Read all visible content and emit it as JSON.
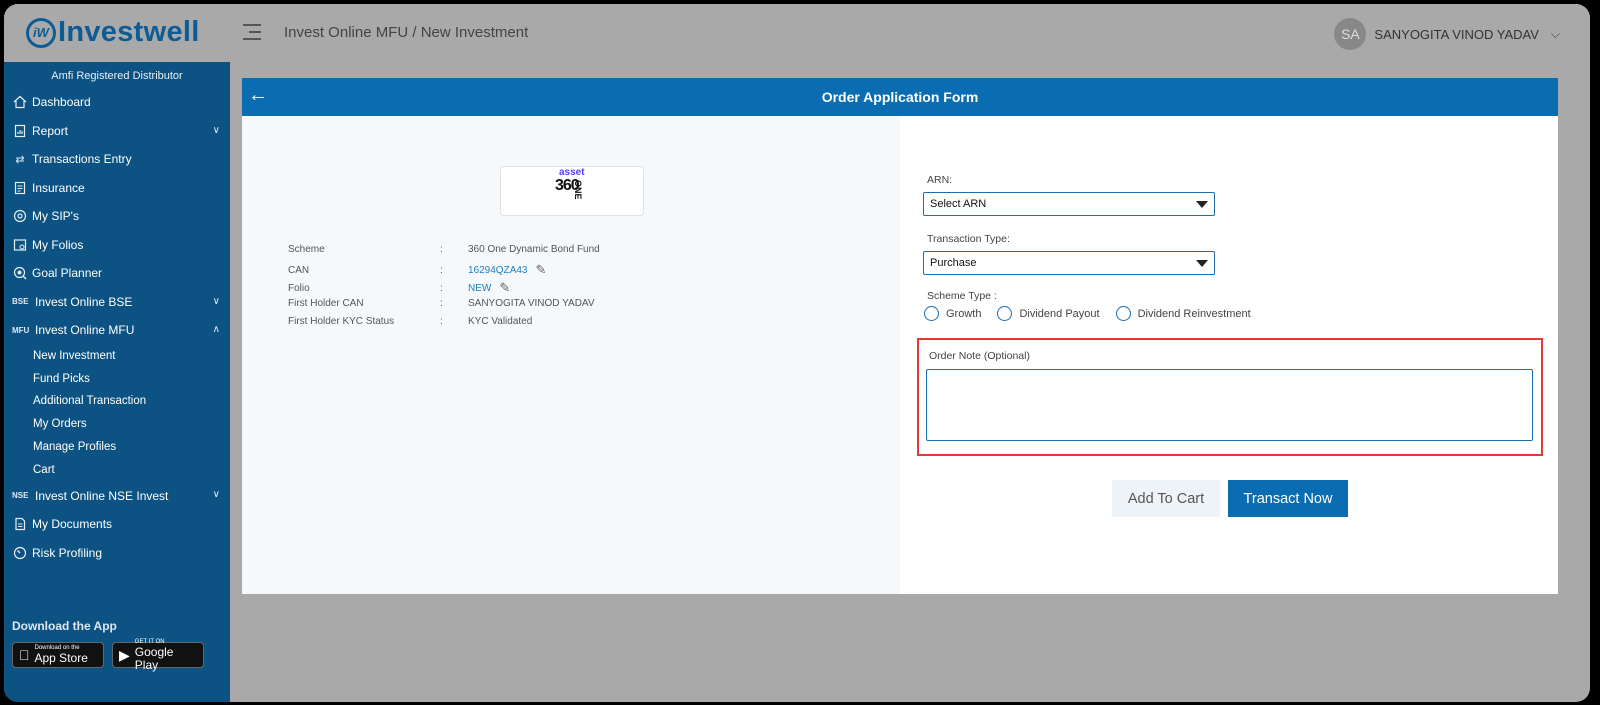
{
  "header": {
    "logo_mark": "iW",
    "brand": "Investwell",
    "breadcrumb": "Invest Online MFU / New Investment",
    "user_initials": "SA",
    "user_name": "SANYOGITA VINOD YADAV"
  },
  "sidebar": {
    "tagline": "Amfi Registered Distributor",
    "items": [
      {
        "label": "Dashboard",
        "icon": "home-icon"
      },
      {
        "label": "Report",
        "icon": "report-icon",
        "expandable": true
      },
      {
        "label": "Transactions Entry",
        "icon": "transfer-icon"
      },
      {
        "label": "Insurance",
        "icon": "insurance-icon"
      },
      {
        "label": "My SIP's",
        "icon": "sip-icon"
      },
      {
        "label": "My Folios",
        "icon": "folios-icon"
      },
      {
        "label": "Goal Planner",
        "icon": "goal-icon"
      },
      {
        "label": "Invest Online BSE",
        "tag": "BSE",
        "expandable": true
      },
      {
        "label": "Invest Online MFU",
        "tag": "MFU",
        "expanded": true
      }
    ],
    "mfu_sub_items": [
      "New Investment",
      "Fund Picks",
      "Additional Transaction",
      "My Orders",
      "Manage Profiles",
      "Cart"
    ],
    "items_after": [
      {
        "label": "Invest Online NSE Invest",
        "tag": "NSE",
        "expandable": true
      },
      {
        "label": "My Documents",
        "icon": "documents-icon"
      },
      {
        "label": "Risk Profiling",
        "icon": "gauge-icon"
      }
    ],
    "download_title": "Download the App",
    "app_store_small": "Download on the",
    "app_store_big": "App Store",
    "google_play_small": "GET IT ON",
    "google_play_big": "Google Play"
  },
  "form": {
    "title": "Order Application Form",
    "fund_logo_top": "asset",
    "fund_logo_num": "360",
    "fund_logo_side": "ONE",
    "info": [
      {
        "label": "Scheme",
        "value": "360 One Dynamic Bond Fund"
      },
      {
        "label": "CAN",
        "value": "16294QZA43",
        "editable": true
      },
      {
        "label": "Folio",
        "value": "NEW",
        "editable": true
      },
      {
        "label": "First Holder CAN",
        "value": "SANYOGITA VINOD YADAV"
      },
      {
        "label": "First Holder KYC Status",
        "value": "KYC Validated"
      }
    ],
    "colon": ":",
    "arn_label": "ARN:",
    "arn_value": "Select ARN",
    "txn_type_label": "Transaction Type:",
    "txn_type_value": "Purchase",
    "scheme_type_label": "Scheme Type :",
    "scheme_options": [
      "Growth",
      "Dividend Payout",
      "Dividend Reinvestment"
    ],
    "note_label": "Order Note (Optional)",
    "add_to_cart": "Add To Cart",
    "transact_now": "Transact Now",
    "colors": {
      "primary": "#0b6db1",
      "sidebar": "#0c5282",
      "highlight": "#e53935"
    }
  }
}
